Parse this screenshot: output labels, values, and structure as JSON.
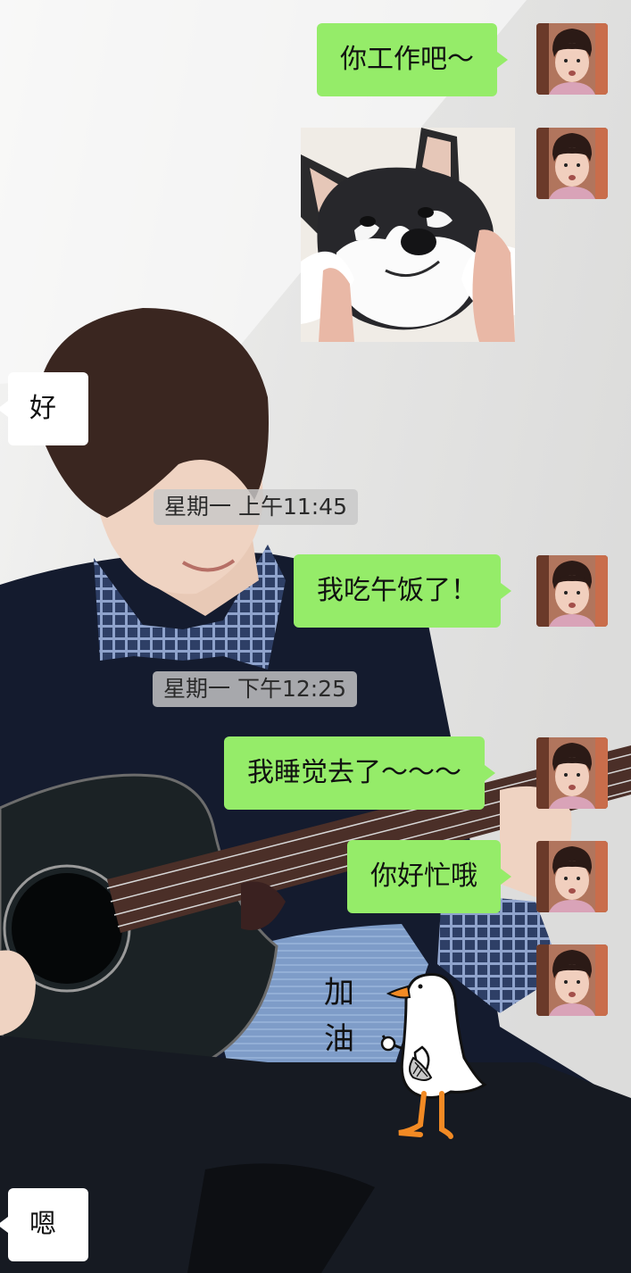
{
  "messages": [
    {
      "side": "right",
      "type": "text",
      "text": "你工作吧～"
    },
    {
      "side": "right",
      "type": "image",
      "image": "husky-dog-face-squeezed"
    },
    {
      "side": "left",
      "type": "text",
      "text": "好"
    },
    {
      "type": "time",
      "text": "星期一 上午11:45"
    },
    {
      "side": "right",
      "type": "text",
      "text": "我吃午饭了！"
    },
    {
      "type": "time",
      "text": "星期一 下午12:25"
    },
    {
      "side": "right",
      "type": "text",
      "text": "我睡觉去了～～～"
    },
    {
      "side": "right",
      "type": "text",
      "text": "你好忙哦"
    },
    {
      "side": "right",
      "type": "sticker",
      "image": "duck-cheer-sticker",
      "sticker_text": "加油"
    },
    {
      "side": "left",
      "type": "text",
      "text": "嗯"
    }
  ],
  "colors": {
    "sent_bubble": "#95ec69",
    "received_bubble": "#ffffff",
    "timestamp_bg": "#c8c8c8"
  }
}
